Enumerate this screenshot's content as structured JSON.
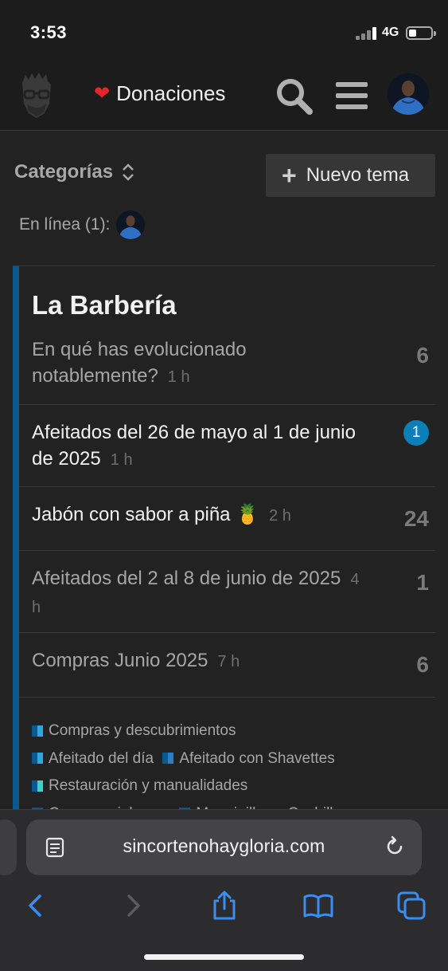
{
  "status_bar": {
    "time": "3:53",
    "network": "4G"
  },
  "header": {
    "donations_label": "Donaciones"
  },
  "toolbar": {
    "categories_label": "Categorías",
    "new_topic_label": "Nuevo tema"
  },
  "online": {
    "label": "En línea (1):"
  },
  "category": {
    "name": "La Barbería",
    "topics": [
      {
        "title": "En qué has evolucionado notablemente?",
        "age": "1 h",
        "replies": "6",
        "state": "read"
      },
      {
        "title": "Afeitados del 26 de mayo al 1 de junio de 2025",
        "age": "1 h",
        "replies": "1",
        "state": "unread-badge"
      },
      {
        "title": "Jabón con sabor a piña 🍍",
        "age": "2 h",
        "replies": "24",
        "state": "unread"
      },
      {
        "title": "Afeitados del 2 al 8 de junio de 2025",
        "age": "4 h",
        "replies": "1",
        "state": "read"
      },
      {
        "title": "Compras Junio 2025",
        "age": "7 h",
        "replies": "6",
        "state": "read"
      }
    ],
    "subcategories": [
      {
        "name": "Compras y descubrimientos"
      },
      {
        "name": "Afeitado del día"
      },
      {
        "name": "Afeitado con Shavettes"
      },
      {
        "name": "Restauración y manualidades"
      },
      {
        "name": "Cremas y jabones"
      },
      {
        "name": "Maquinillas y Cuchillas"
      }
    ]
  },
  "browser": {
    "url": "sincortenohaygloria.com"
  },
  "colors": {
    "category_accent": "#0b5a8f",
    "badge": "#0a7fb8",
    "browser_accent": "#3b8ef0"
  }
}
